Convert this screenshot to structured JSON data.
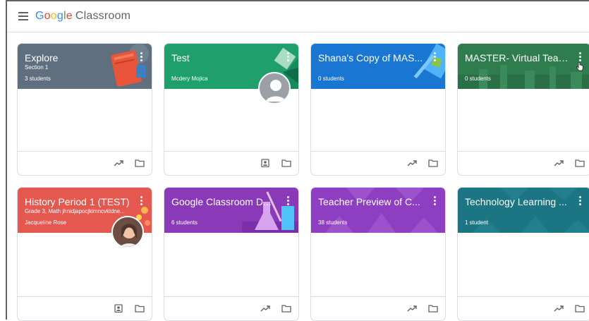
{
  "header": {
    "logo_google": [
      "G",
      "o",
      "o",
      "g",
      "l",
      "e"
    ],
    "logo_product": "Classroom",
    "logo_colors": [
      "#4285f4",
      "#ea4335",
      "#fbbc05",
      "#4285f4",
      "#34a853",
      "#ea4335"
    ]
  },
  "classes": [
    {
      "name": "Explore",
      "section": "Section 1",
      "meta": "3 students",
      "theme": "#5f6f7f",
      "illustration": "book",
      "footer_icons": [
        "trending-up-icon",
        "folder-icon"
      ]
    },
    {
      "name": "Test",
      "section": "",
      "meta": "Mcdery Mojica",
      "theme": "#1e9f6b",
      "illustration": "shapes",
      "avatar": "default-avatar",
      "footer_icons": [
        "assignment-ind-icon",
        "folder-icon"
      ]
    },
    {
      "name": "Shana's Copy of MAS...",
      "section": "",
      "meta": "0 students",
      "theme": "#1976d2",
      "illustration": "pencil",
      "footer_icons": [
        "trending-up-icon",
        "folder-icon"
      ]
    },
    {
      "name": "MASTER- Virtual Teac...",
      "section": "",
      "meta": "0 students",
      "theme": "#2f7d4f",
      "illustration": "skyline",
      "footer_icons": [
        "trending-up-icon",
        "folder-icon"
      ]
    },
    {
      "name": "History Period 1 (TEST)",
      "section": "Grade 3, Math jhnidjapocjkimncvkldne...",
      "meta": "Jacqueline Rose",
      "theme": "#e5584f",
      "illustration": "flowers",
      "avatar": "teacher-photo",
      "footer_icons": [
        "assignment-ind-icon",
        "folder-icon"
      ]
    },
    {
      "name": "Google Classroom D...",
      "section": "",
      "meta": "6 students",
      "theme": "#8a3ab9",
      "illustration": "flask",
      "footer_icons": [
        "trending-up-icon",
        "folder-icon"
      ]
    },
    {
      "name": "Teacher Preview of C...",
      "section": "",
      "meta": "38 students",
      "theme": "#8e3ec1",
      "illustration": "pattern",
      "footer_icons": [
        "trending-up-icon",
        "folder-icon"
      ]
    },
    {
      "name": "Technology Learning ...",
      "section": "",
      "meta": "1 student",
      "theme": "#1b7583",
      "illustration": "pattern",
      "footer_icons": [
        "trending-up-icon",
        "folder-icon"
      ]
    }
  ]
}
